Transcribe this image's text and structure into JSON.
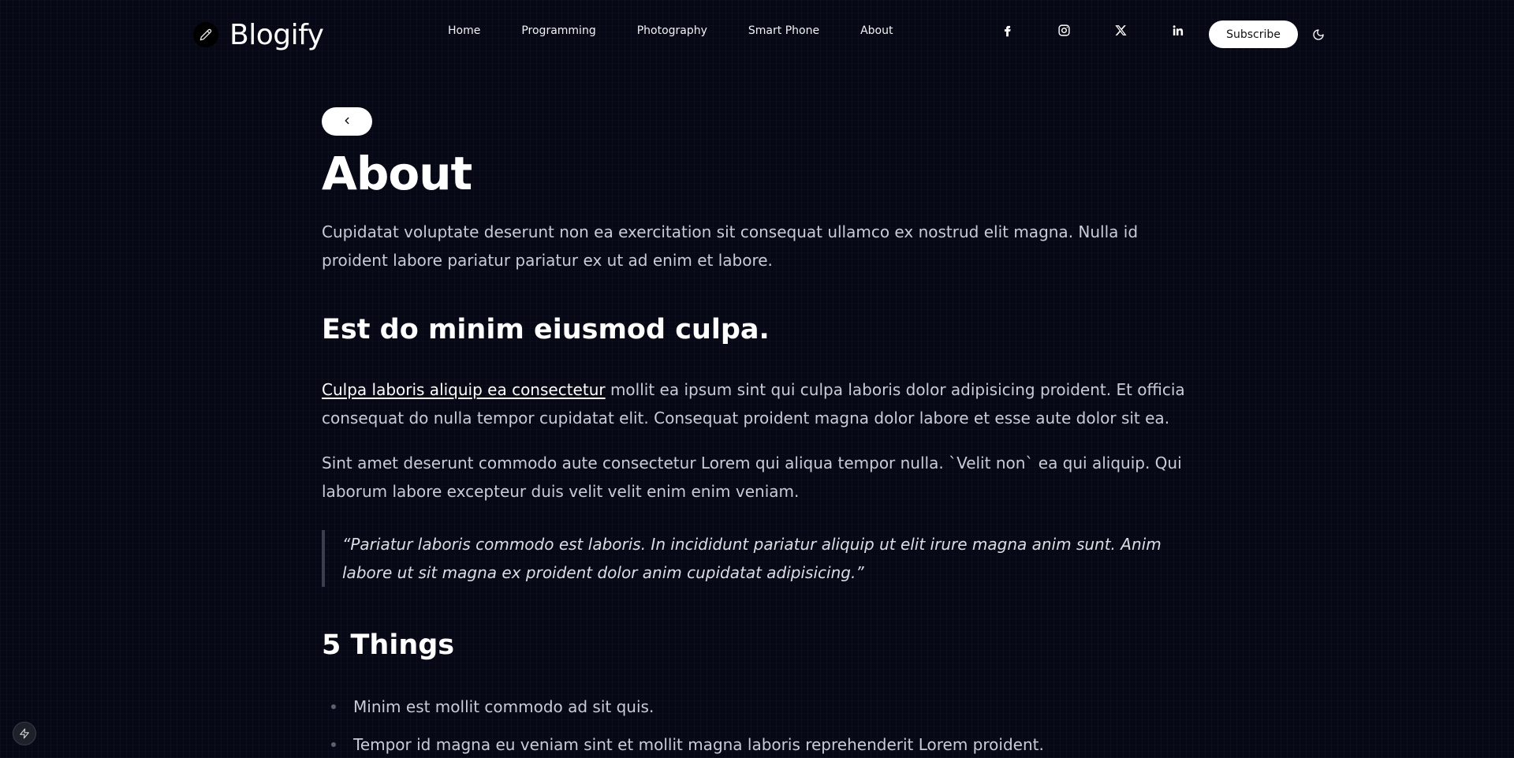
{
  "header": {
    "brand": "Blogify",
    "nav": [
      "Home",
      "Programming",
      "Photography",
      "Smart Phone",
      "About"
    ],
    "socials": [
      "facebook-icon",
      "instagram-icon",
      "x-icon",
      "linkedin-icon"
    ],
    "subscribe_label": "Subscribe"
  },
  "article": {
    "title": "About",
    "intro": "Cupidatat voluptate deserunt non ea exercitation sit consequat ullamco ex nostrud elit magna. Nulla id proident labore pariatur pariatur ex ut ad enim et labore.",
    "heading1": "Est do minim eiusmod culpa.",
    "para1_link": "Culpa laboris aliquip ea consectetur",
    "para1_rest": " mollit ea ipsum sint qui culpa laboris dolor adipisicing proident. Et officia consequat do nulla tempor cupidatat elit. Consequat proident magna dolor labore et esse aute dolor sit ea.",
    "para2": "Sint amet deserunt commodo aute consectetur Lorem qui aliqua tempor nulla. `Velit non` ea qui aliquip. Qui laborum labore excepteur duis velit velit enim enim veniam.",
    "quote": "“Pariatur laboris commodo est laboris. In incididunt pariatur aliquip ut elit irure magna anim sunt. Anim labore ut sit magna ex proident dolor anim cupidatat adipisicing.”",
    "heading2": "5 Things",
    "list": [
      "Minim est mollit commodo ad sit quis.",
      "Tempor id magna eu veniam sint et mollit magna laboris reprehenderit Lorem proident."
    ]
  }
}
